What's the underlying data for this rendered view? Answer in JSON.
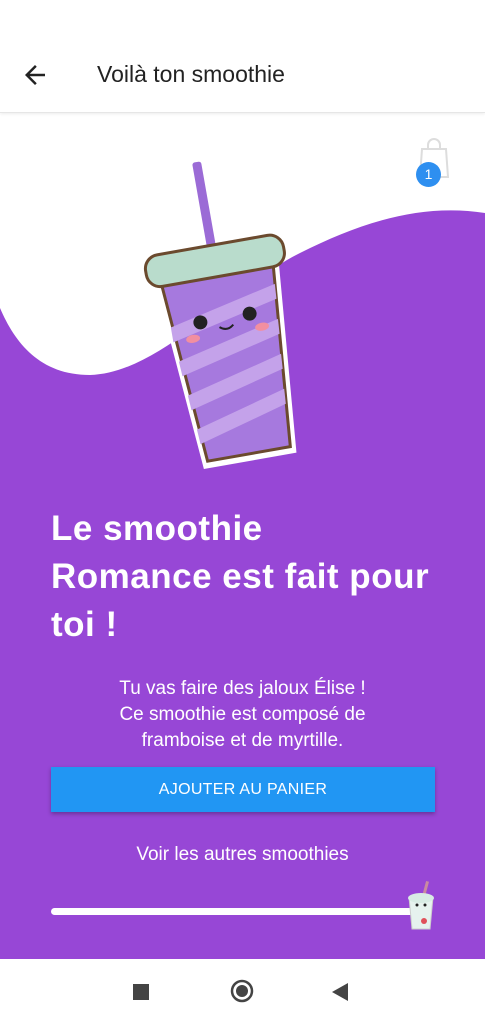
{
  "appbar": {
    "title": "Voilà ton smoothie",
    "back_icon": "arrow-left-icon"
  },
  "cart": {
    "count": "1",
    "icon": "shopping-bag-icon"
  },
  "result": {
    "headline": "Le smoothie Romance est fait pour toi !",
    "description_lines": [
      "Tu vas faire des jaloux Élise !",
      "Ce smoothie est composé de",
      "framboise et de myrtille."
    ]
  },
  "actions": {
    "add_to_cart": "AJOUTER AU PANIER",
    "see_others": "Voir les autres smoothies"
  },
  "slider": {
    "value_percent": 100
  },
  "colors": {
    "background": "#9747d6",
    "button": "#2196f3",
    "badge": "#2e8ff0"
  }
}
